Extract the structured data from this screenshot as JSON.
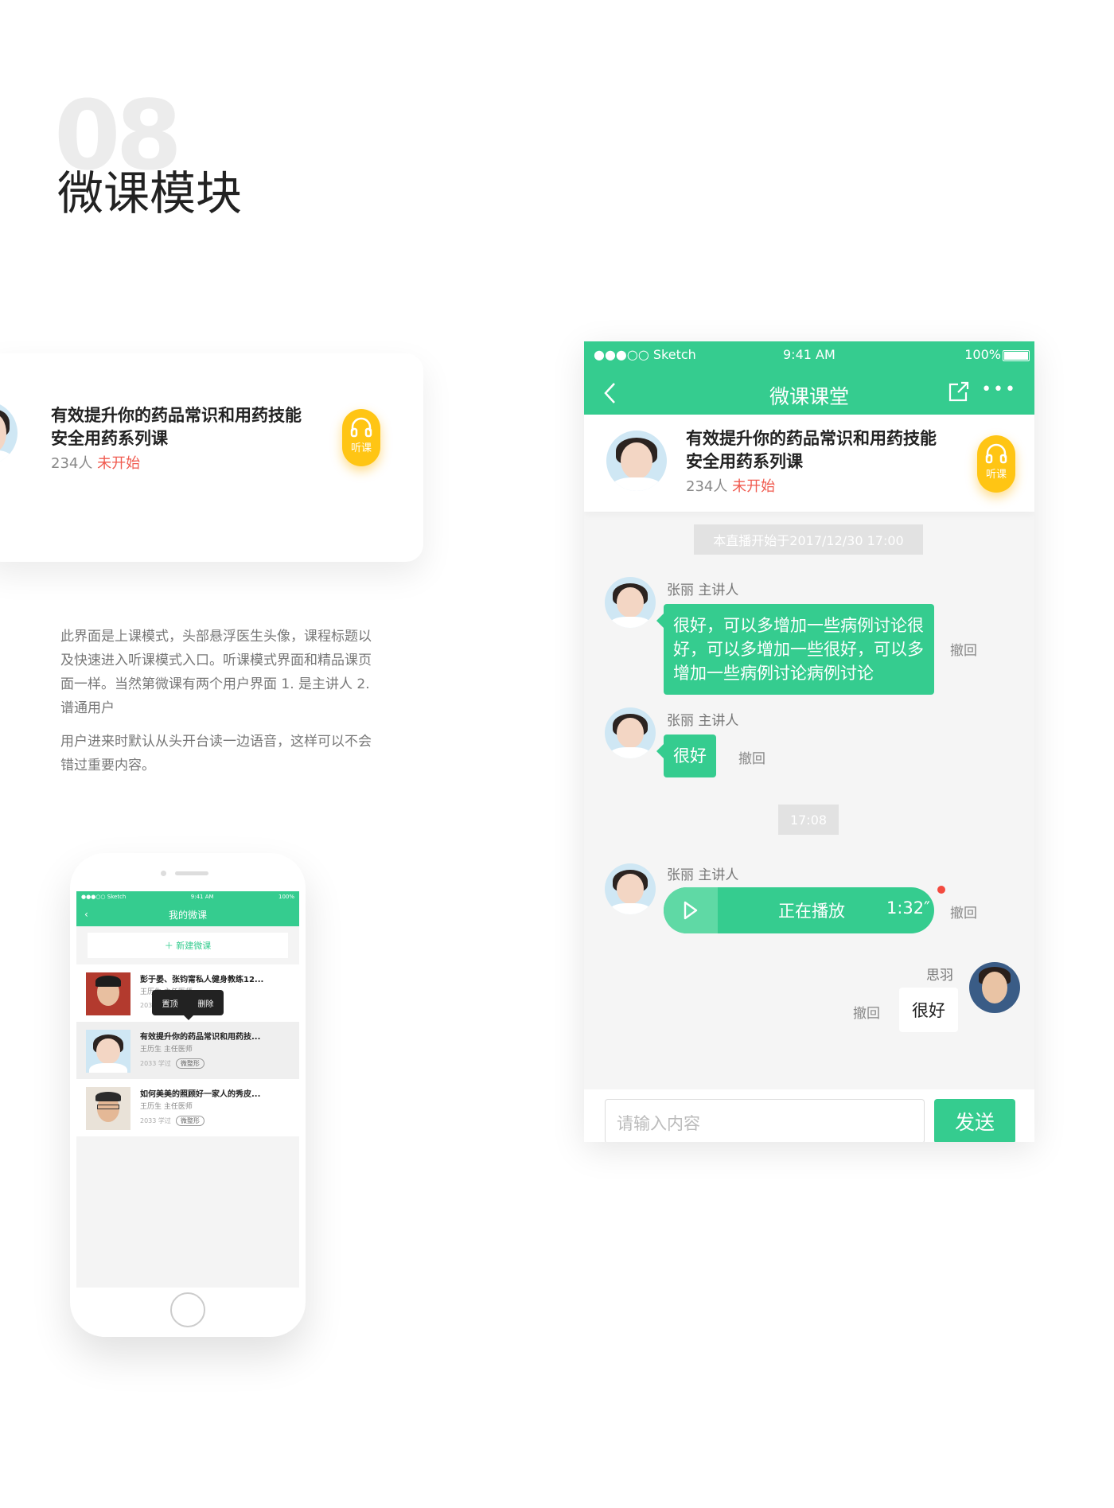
{
  "page": {
    "bg_number": "08",
    "section_title": "微课模块"
  },
  "course": {
    "title_line1": "有效提升你的药品常识和用药技能",
    "title_line2": "安全用药系列课",
    "count": "234人",
    "status": "未开始",
    "listen_label": "听课"
  },
  "description": {
    "para1": "此界面是上课模式，头部悬浮医生头像，课程标题以及快速进入听课模式入口。听课模式界面和精品课页面一样。当然第微课有两个用户界面 1. 是主讲人   2. 谱通用户",
    "para2": "用户进来时默认从头开台读一边语音，这样可以不会错过重要内容。"
  },
  "small_phone": {
    "status_left": "●●●○○ Sketch",
    "status_time": "9:41 AM",
    "status_battery": "100%",
    "nav_title": "我的微课",
    "new_course": "＋  新建微课",
    "popup": {
      "pin": "置顶",
      "delete": "删除"
    },
    "items": [
      {
        "title": "彭于晏、张钧甯私人健身教练12...",
        "sub": "王历生  主任医师",
        "meta": "2033 学过",
        "tag": ""
      },
      {
        "title": "有效提升你的药品常识和用药技...",
        "sub": "王历生  主任医师",
        "meta": "2033 学过",
        "tag": "微整形"
      },
      {
        "title": "如何美美的照顾好一家人的秀皮...",
        "sub": "王历生  主任医师",
        "meta": "2033 学过",
        "tag": "微整形"
      }
    ]
  },
  "big_phone": {
    "status_left": "●●●○○ Sketch",
    "status_time": "9:41 AM",
    "status_battery": "100%",
    "nav_title": "微课课堂",
    "notice": "本直播开始于2017/12/30  17:00",
    "time_chip": "17:08",
    "speaker": "张丽 主讲人",
    "msg1": "很好，可以多增加一些病例讨论很好，可以多增加一些很好，可以多增加一些病例讨论病例讨论",
    "msg2": "很好",
    "recall": "撤回",
    "voice_label": "正在播放",
    "voice_duration": "1:32″",
    "user_name": "思羽",
    "user_msg": "很好",
    "input_placeholder": "请输入内容",
    "send": "发送"
  },
  "colors": {
    "primary": "#35cc8f",
    "accent": "#ffc514",
    "alert": "#f05a4f"
  }
}
